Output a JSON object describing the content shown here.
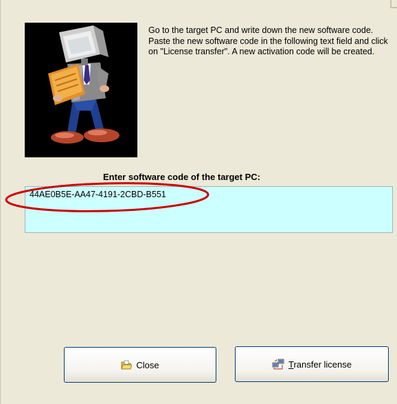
{
  "instructions": "Go to the target PC and write down the new software code. Paste the new software code in the following text field and click on \"License transfer\". A new activation code will be created.",
  "field_label": "Enter software code of the target PC:",
  "software_code": "44AE0B5E-AA47-4191-2CBD-B551",
  "buttons": {
    "close_label": "Close",
    "transfer_mnemonic": "T",
    "transfer_rest": "ransfer license"
  },
  "icons": {
    "illustration": "computer-man-reading-icon",
    "close": "folder-open-icon",
    "transfer": "transfer-computers-icon"
  },
  "colors": {
    "dialog_bg": "#ece9d8",
    "field_bg": "#ccffff",
    "highlight_ellipse": "#cc0000"
  }
}
